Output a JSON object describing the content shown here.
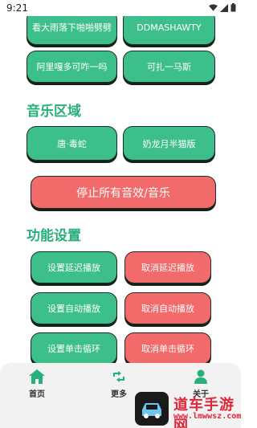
{
  "status_bar": {
    "time": "9:21"
  },
  "top_buttons": [
    {
      "label": "看大雨落下啪啪劈劈"
    },
    {
      "label": "DDMASHAWTY"
    },
    {
      "label": "阿里嘎多可咋一吗"
    },
    {
      "label": "可扎一马斯"
    }
  ],
  "music_section": {
    "title": "音乐区域",
    "buttons": [
      {
        "label": "唐·毒蛇"
      },
      {
        "label": "奶龙月半猫版"
      }
    ],
    "stop_all": "停止所有音效/音乐"
  },
  "function_section": {
    "title": "功能设置",
    "rows": [
      {
        "set": "设置延迟播放",
        "cancel": "取消延迟播放"
      },
      {
        "set": "设置自动播放",
        "cancel": "取消自动播放"
      },
      {
        "set": "设置单击循环",
        "cancel": "取消单击循环"
      }
    ]
  },
  "bottom_nav": {
    "home": "首页",
    "more": "更多",
    "third": "关于"
  },
  "watermark": {
    "text": "道车手游网",
    "url": "www.lmwwsz.com"
  },
  "colors": {
    "accent_green": "#3dbf8c",
    "title_green": "#27b07c",
    "danger_red": "#f26a6a"
  }
}
